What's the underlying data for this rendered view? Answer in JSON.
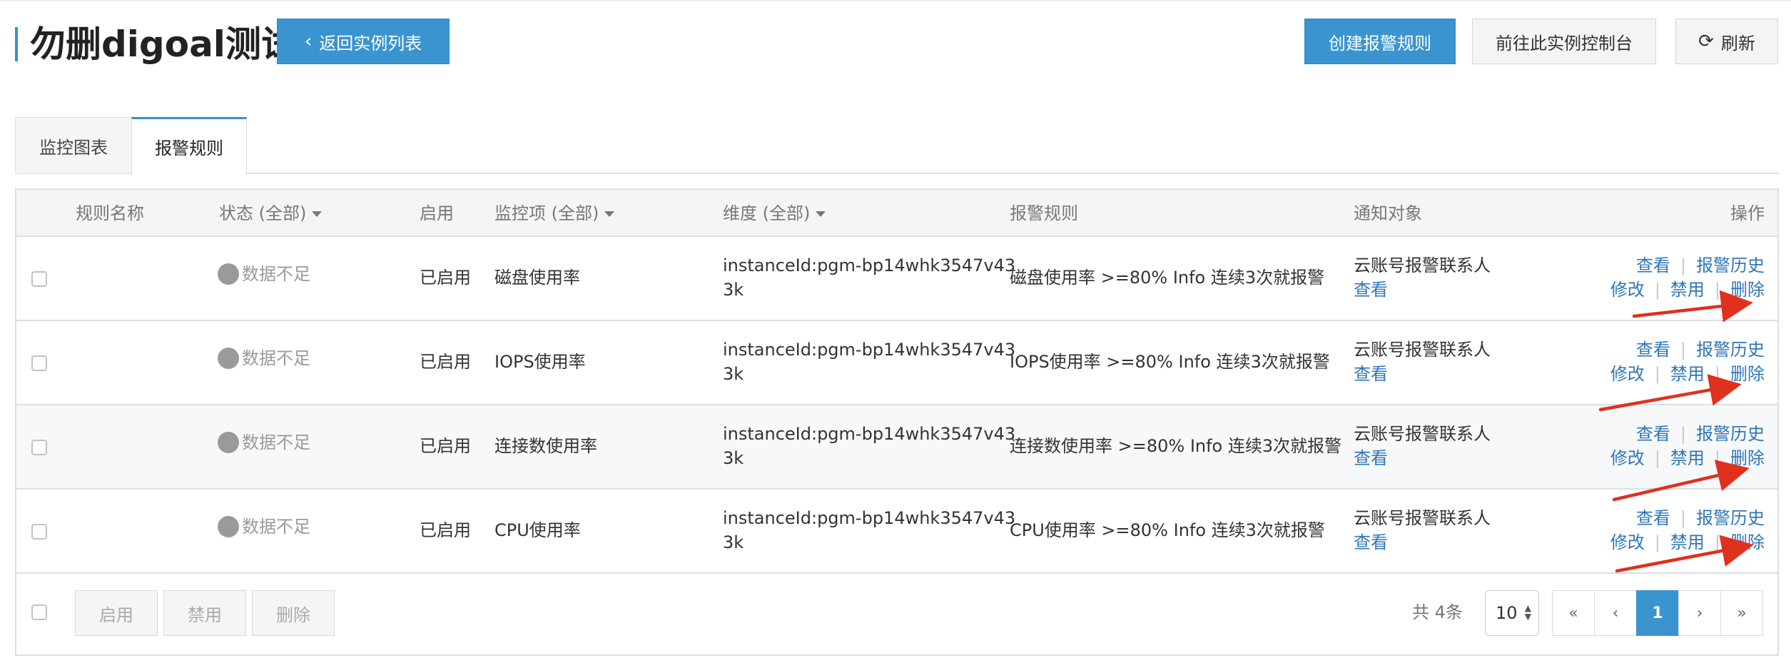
{
  "header": {
    "title": "勿删digoal测试",
    "back_button": "返回实例列表",
    "create_rule_button": "创建报警规则",
    "console_button": "前往此实例控制台",
    "refresh_button": "刷新"
  },
  "tabs": [
    {
      "label": "监控图表",
      "active": false
    },
    {
      "label": "报警规则",
      "active": true
    }
  ],
  "table": {
    "columns": {
      "rule_name": "规则名称",
      "status": "状态 (全部)",
      "enabled": "启用",
      "metric": "监控项 (全部)",
      "dimension": "维度 (全部)",
      "alarm_rule": "报警规则",
      "notify": "通知对象",
      "actions": "操作"
    },
    "rows": [
      {
        "status": "数据不足",
        "enabled": "已启用",
        "metric": "磁盘使用率",
        "dim_line1": "instanceId:pgm-bp14whk3547v43",
        "dim_line2": "3k",
        "rule": "磁盘使用率 >=80% Info 连续3次就报警",
        "notify_name": "云账号报警联系人",
        "notify_link": "查看"
      },
      {
        "status": "数据不足",
        "enabled": "已启用",
        "metric": "IOPS使用率",
        "dim_line1": "instanceId:pgm-bp14whk3547v43",
        "dim_line2": "3k",
        "rule": "IOPS使用率 >=80% Info 连续3次就报警",
        "notify_name": "云账号报警联系人",
        "notify_link": "查看"
      },
      {
        "status": "数据不足",
        "enabled": "已启用",
        "metric": "连接数使用率",
        "dim_line1": "instanceId:pgm-bp14whk3547v43",
        "dim_line2": "3k",
        "rule": "连接数使用率 >=80% Info 连续3次就报警",
        "notify_name": "云账号报警联系人",
        "notify_link": "查看"
      },
      {
        "status": "数据不足",
        "enabled": "已启用",
        "metric": "CPU使用率",
        "dim_line1": "instanceId:pgm-bp14whk3547v43",
        "dim_line2": "3k",
        "rule": "CPU使用率 >=80% Info 连续3次就报警",
        "notify_name": "云账号报警联系人",
        "notify_link": "查看"
      }
    ],
    "row_actions": {
      "view": "查看",
      "history": "报警历史",
      "edit": "修改",
      "disable": "禁用",
      "delete": "删除"
    }
  },
  "footer": {
    "batch_enable": "启用",
    "batch_disable": "禁用",
    "batch_delete": "删除",
    "total": "共 4条",
    "page_size": "10",
    "first": "«",
    "prev": "‹",
    "current_page": "1",
    "next": "›",
    "last": "»"
  },
  "colors": {
    "primary": "#3a94d0",
    "link": "#2f76b8",
    "annotation_arrow": "#e0301e"
  },
  "icons": {
    "back": "chevron-left-icon",
    "refresh": "refresh-icon",
    "sort": "caret-down-icon",
    "status": "gray-circle-icon",
    "page_size": "up-down-arrow-icon",
    "annotation": "red-arrow-icon"
  }
}
